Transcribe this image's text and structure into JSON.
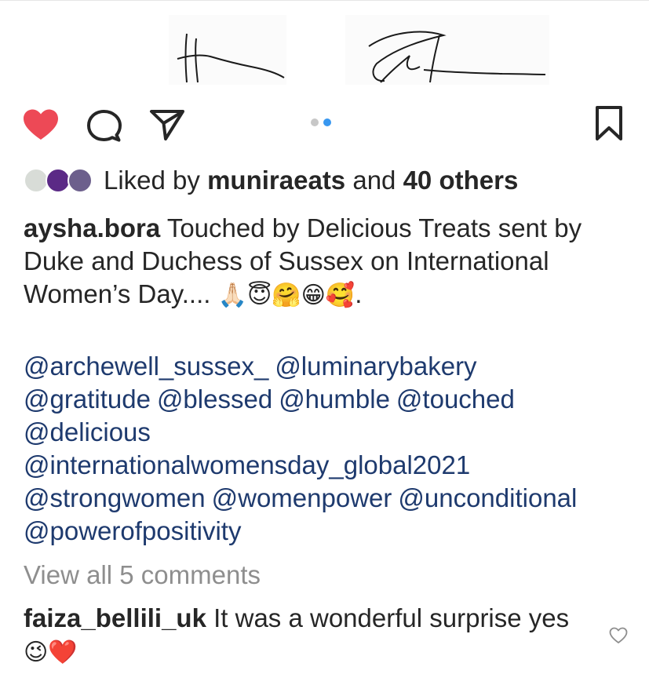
{
  "post": {
    "likes": {
      "prefix": "Liked by",
      "first_liker": "muniraeats",
      "joiner": "and",
      "others": "40 others"
    },
    "caption": {
      "username": "aysha.bora",
      "text": "Touched by Delicious Treats sent by Duke and Duchess of Sussex on International Women’s Day.... ",
      "emojis": "🙏🏻😇🤗😁🥰",
      "trailing": "."
    },
    "hashtags": [
      "@archewell_sussex_",
      "@luminarybakery",
      "@gratitude",
      "@blessed",
      "@humble",
      "@touched",
      "@delicious",
      "@internationalwomensday_global2021",
      "@strongwomen",
      "@womenpower",
      "@unconditional",
      "@powerofpositivity"
    ],
    "view_all_comments": "View all 5 comments",
    "comment": {
      "username": "faiza_bellili_uk",
      "text": "It was a wonderful  surprise yes ",
      "emojis": "😉❤️"
    },
    "carousel": {
      "count": 2,
      "active_index": 1
    }
  },
  "icons": {
    "like": "heart-filled-icon",
    "comment": "comment-bubble-icon",
    "share": "paper-plane-icon",
    "save": "bookmark-icon",
    "comment_like": "heart-outline-icon"
  },
  "colors": {
    "like_red": "#ed4956",
    "link_blue": "#1e3a6e",
    "carousel_active": "#3897f0",
    "muted": "#8e8e8e"
  }
}
